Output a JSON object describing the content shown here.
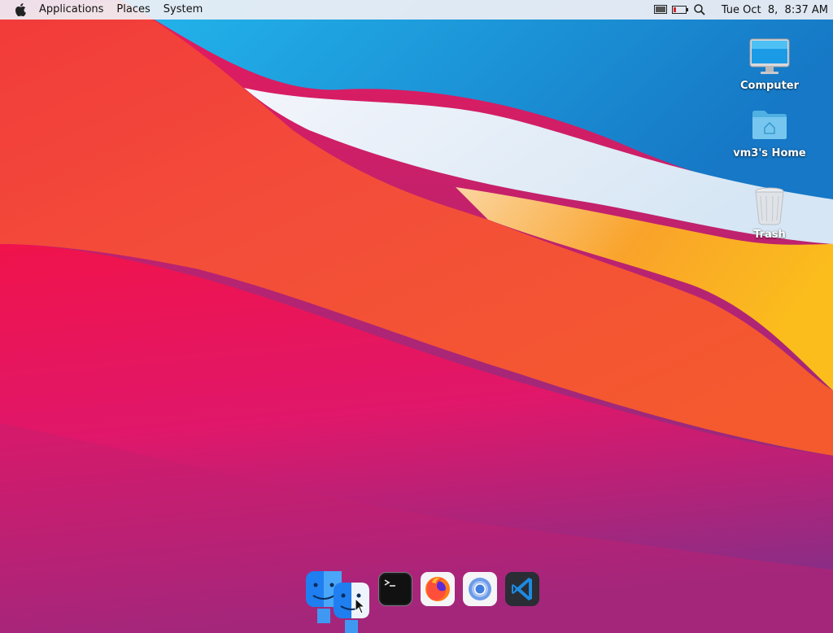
{
  "menubar": {
    "apple_icon": "apple-logo-icon",
    "items": [
      {
        "label": "Applications"
      },
      {
        "label": "Places"
      },
      {
        "label": "System"
      }
    ],
    "tray": [
      {
        "icon": "display-icon"
      },
      {
        "icon": "battery-icon"
      },
      {
        "icon": "search-icon"
      }
    ],
    "clock": "Tue Oct  8,  8:37 AM"
  },
  "desktop_icons": [
    {
      "label": "Computer",
      "icon": "computer-icon"
    },
    {
      "label": "vm3's Home",
      "icon": "home-folder-icon"
    },
    {
      "label": "Trash",
      "icon": "trash-icon"
    }
  ],
  "dock": {
    "items": [
      {
        "name": "Finder",
        "icon": "finder-icon"
      },
      {
        "name": "Terminal",
        "icon": "terminal-icon"
      },
      {
        "name": "Firefox",
        "icon": "firefox-icon"
      },
      {
        "name": "Chromium",
        "icon": "chromium-icon"
      },
      {
        "name": "Visual Studio Code",
        "icon": "vscode-icon"
      }
    ]
  },
  "colors": {
    "menubar_bg": "#f0f0f5",
    "wallpaper_red": "#ee2a4a",
    "wallpaper_blue": "#1d8fd6",
    "wallpaper_orange": "#f7a21c",
    "wallpaper_purple": "#a8277a"
  }
}
